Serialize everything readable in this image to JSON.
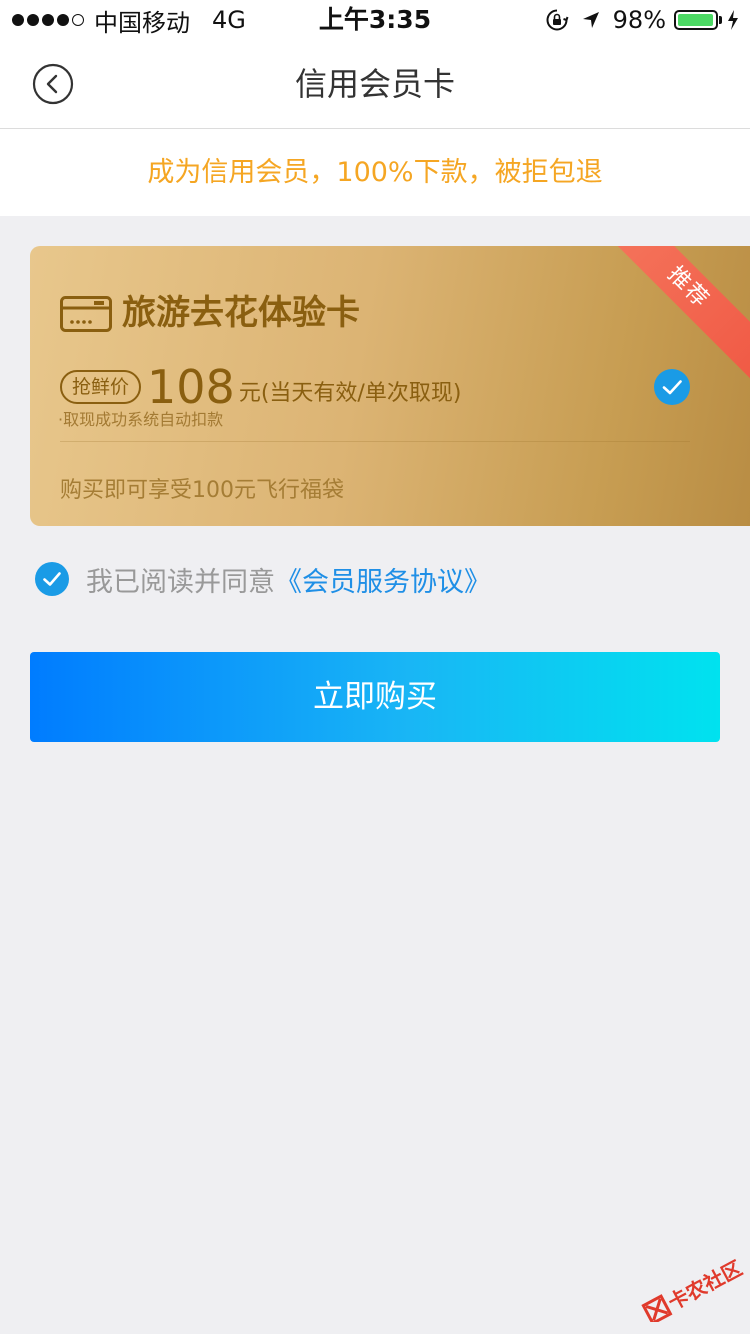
{
  "status_bar": {
    "carrier": "中国移动",
    "network": "4G",
    "time": "上午3:35",
    "battery_percent": "98%",
    "battery_level": 0.98,
    "icons": [
      "signal-dots-icon",
      "orientation-lock-icon",
      "location-arrow-icon",
      "battery-icon",
      "charging-bolt-icon"
    ]
  },
  "nav": {
    "title": "信用会员卡",
    "back_icon": "back-circle-icon"
  },
  "promo": {
    "text": "成为信用会员，100%下款，被拒包退",
    "color": "#f5a623"
  },
  "card": {
    "ribbon": "推荐",
    "name": "旅游去花体验卡",
    "price_tag": "抢鲜价",
    "price_value": "108",
    "price_unit": "元(当天有效/单次取现)",
    "note": "·取现成功系统自动扣款",
    "benefit": "购买即可享受100元飞行福袋",
    "selected": true,
    "colors": {
      "text": "#8a5f10",
      "ribbon": "#f05a45",
      "check": "#1a9be6"
    }
  },
  "agreement": {
    "checked": true,
    "text": "我已阅读并同意",
    "link": "《会员服务协议》",
    "link_color": "#1f8fe6"
  },
  "buy_button": {
    "label": "立即购买"
  },
  "watermark": {
    "text": "卡农社区"
  }
}
